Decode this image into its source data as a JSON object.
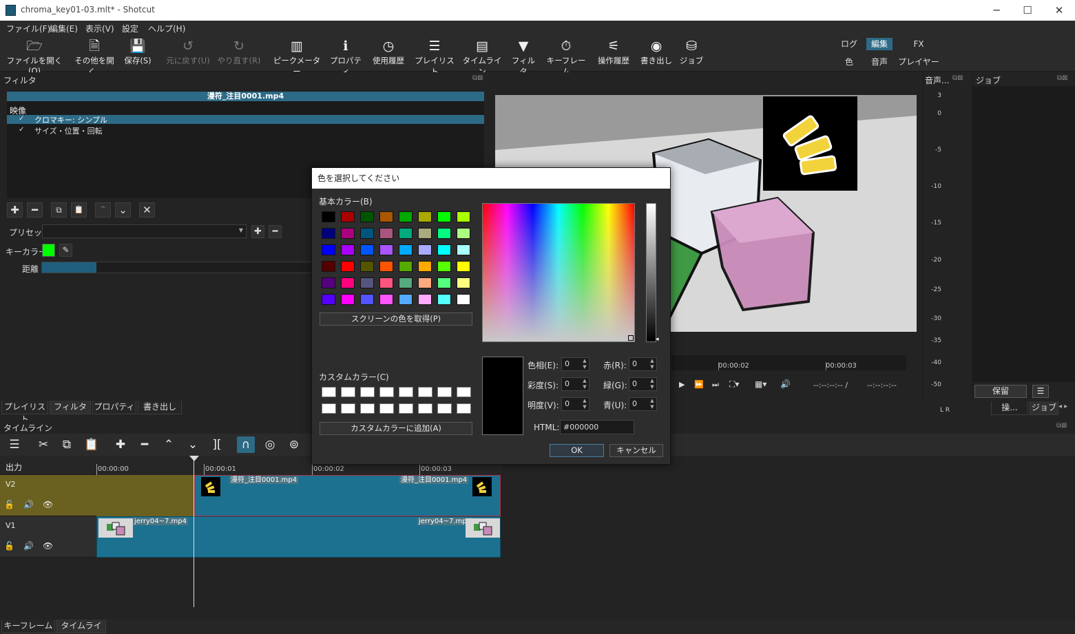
{
  "window": {
    "title": "chroma_key01-03.mlt* - Shotcut",
    "controls": [
      "─",
      "☐",
      "✕"
    ]
  },
  "menu": [
    "ファイル(F)",
    "編集(E)",
    "表示(V)",
    "設定",
    "ヘルプ(H)"
  ],
  "toolbar": [
    {
      "label": "ファイルを開く(O)",
      "icon": "folder-open-icon",
      "glyph": "🗁"
    },
    {
      "label": "その他を開く..",
      "icon": "open-other-icon",
      "glyph": "🗎"
    },
    {
      "label": "保存(S)",
      "icon": "save-icon",
      "glyph": "💾"
    },
    {
      "label": "元に戻す(U)",
      "icon": "undo-icon",
      "glyph": "↺"
    },
    {
      "label": "やり直す(R)",
      "icon": "redo-icon",
      "glyph": "↻"
    },
    {
      "label": "ピークメーター",
      "icon": "peak-meter-icon",
      "glyph": "▥"
    },
    {
      "label": "プロパティ",
      "icon": "info-icon",
      "glyph": "ℹ"
    },
    {
      "label": "使用履歴",
      "icon": "clock-icon",
      "glyph": "◷"
    },
    {
      "label": "プレイリスト",
      "icon": "list-icon",
      "glyph": "☰"
    },
    {
      "label": "タイムライン",
      "icon": "timeline-icon",
      "glyph": "▤"
    },
    {
      "label": "フィルタ",
      "icon": "filter-icon",
      "glyph": "▼"
    },
    {
      "label": "キーフレーム",
      "icon": "stopwatch-icon",
      "glyph": "⏱"
    },
    {
      "label": "操作履歴",
      "icon": "history-icon",
      "glyph": "⚟"
    },
    {
      "label": "書き出し",
      "icon": "export-disc-icon",
      "glyph": "◉"
    },
    {
      "label": "ジョブ",
      "icon": "jobs-stack-icon",
      "glyph": "⛁"
    }
  ],
  "layouts": {
    "row1": [
      "ログ",
      "編集",
      "FX"
    ],
    "row2": [
      "色",
      "音声",
      "プレイヤー"
    ],
    "active": "編集"
  },
  "filter_panel": {
    "title": "フィルタ",
    "clip_name": "漫符_注目0001.mp4",
    "section": "映像",
    "filters": [
      {
        "check": "✓",
        "name": "クロマキー: シンプル"
      },
      {
        "check": "✓",
        "name": "サイズ・位置・回転"
      }
    ],
    "buttons": [
      "✚",
      "━",
      "⧉",
      "📋",
      "⌃",
      "⌄",
      "✕"
    ],
    "preset_label": "プリセット",
    "key_color_label": "キーカラー",
    "key_color": "#00ff00",
    "distance_label": "距離",
    "distance_value": 0.2
  },
  "bottom_tabs": [
    "プレイリスト",
    "フィルタ",
    "プロパティ",
    "書き出し"
  ],
  "player": {
    "ruler": [
      "00:00:02",
      "00:00:03"
    ],
    "timecode_current": "--:--:--:-- /",
    "timecode_total": "--:--:--:--"
  },
  "audio_panel": {
    "title": "音声...",
    "scale": [
      "3",
      "0",
      "-5",
      "-10",
      "-15",
      "-20",
      "-25",
      "-30",
      "-35",
      "-40",
      "-50"
    ],
    "lr": "L R"
  },
  "jobs_panel": {
    "title": "ジョブ",
    "hold_button": "保留",
    "menu_glyph": "☰",
    "tabs": [
      "操...",
      "ジョブ"
    ]
  },
  "timeline": {
    "title": "タイムライン",
    "output_label": "出力",
    "ruler": [
      "00:00:00",
      "00:00:01",
      "00:00:02",
      "00:00:03"
    ],
    "tracks": [
      {
        "name": "V2",
        "clip_left": "漫符_注目0001.mp4",
        "clip_right": "漫符_注目0001.mp4"
      },
      {
        "name": "V1",
        "clip_left": "jerry04~7.mp4",
        "clip_right": "jerry04~7.mp4"
      }
    ]
  },
  "bottom_bar_tabs": [
    "キーフレーム",
    "タイムライン"
  ],
  "color_dialog": {
    "title": "色を選択してください",
    "basic_label": "基本カラー(B)",
    "basic_colors": [
      "#000000",
      "#aa0000",
      "#005500",
      "#aa5500",
      "#00aa00",
      "#aaaa00",
      "#00ff00",
      "#aaff00",
      "#00007f",
      "#aa007f",
      "#00557f",
      "#aa557f",
      "#00aa7f",
      "#aaaa7f",
      "#00ff7f",
      "#aaff7f",
      "#0000ff",
      "#aa00ff",
      "#0055ff",
      "#aa55ff",
      "#00aaff",
      "#aaaaff",
      "#00ffff",
      "#aaffff",
      "#550000",
      "#ff0000",
      "#555500",
      "#ff5500",
      "#55aa00",
      "#ffaa00",
      "#55ff00",
      "#ffff00",
      "#55007f",
      "#ff007f",
      "#55557f",
      "#ff557f",
      "#55aa7f",
      "#ffaa7f",
      "#55ff7f",
      "#ffff7f",
      "#5500ff",
      "#ff00ff",
      "#5555ff",
      "#ff55ff",
      "#55aaff",
      "#ffaaff",
      "#55ffff",
      "#ffffff"
    ],
    "pick_screen": "スクリーンの色を取得(P)",
    "custom_label": "カスタムカラー(C)",
    "add_custom": "カスタムカラーに追加(A)",
    "fields": [
      {
        "label": "色相(E):",
        "value": "0"
      },
      {
        "label": "彩度(S):",
        "value": "0"
      },
      {
        "label": "明度(V):",
        "value": "0"
      },
      {
        "label": "赤(R):",
        "value": "0"
      },
      {
        "label": "緑(G):",
        "value": "0"
      },
      {
        "label": "青(U):",
        "value": "0"
      }
    ],
    "html_label": "HTML:",
    "html_value": "#000000",
    "ok": "OK",
    "cancel": "キャンセル",
    "current_color": "#000000"
  }
}
